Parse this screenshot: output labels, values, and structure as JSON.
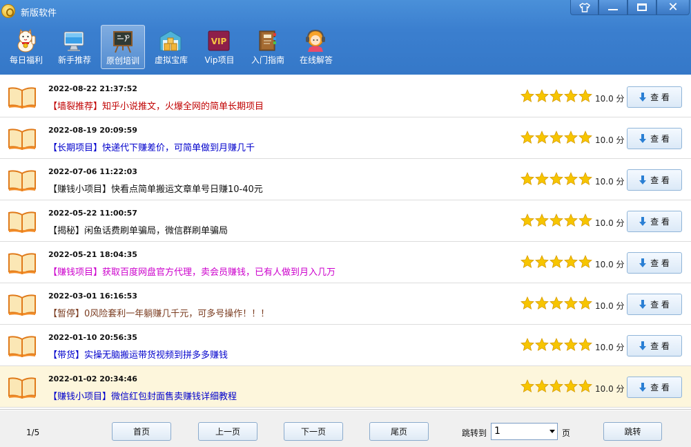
{
  "window": {
    "title": "新版软件"
  },
  "nav": {
    "items": [
      {
        "label": "每日福利",
        "icon": "lucky-cat-icon"
      },
      {
        "label": "新手推荐",
        "icon": "monitor-icon"
      },
      {
        "label": "原创培训",
        "icon": "blackboard-icon",
        "active": true
      },
      {
        "label": "虚拟宝库",
        "icon": "warehouse-icon"
      },
      {
        "label": "Vip项目",
        "icon": "vip-icon",
        "badge": "VIP"
      },
      {
        "label": "入门指南",
        "icon": "guide-book-icon"
      },
      {
        "label": "在线解答",
        "icon": "support-agent-icon"
      }
    ]
  },
  "list": {
    "items": [
      {
        "date": "2022-08-22 21:37:52",
        "title": "【墙裂推荐】知乎小说推文，火爆全网的简单长期项目",
        "color": "#c00000",
        "rating": 5,
        "score": "10.0 分",
        "button": "查 看"
      },
      {
        "date": "2022-08-19 20:09:59",
        "title": "【长期项目】快递代下赚差价，可简单做到月赚几千",
        "color": "#0000cc",
        "rating": 5,
        "score": "10.0 分",
        "button": "查 看"
      },
      {
        "date": "2022-07-06 11:22:03",
        "title": "【赚钱小项目】快看点简单搬运文章单号日赚10-40元",
        "color": "#111111",
        "rating": 5,
        "score": "10.0 分",
        "button": "查 看"
      },
      {
        "date": "2022-05-22 11:00:57",
        "title": "【揭秘】闲鱼话费刷单骗局，微信群刷单骗局",
        "color": "#111111",
        "rating": 5,
        "score": "10.0 分",
        "button": "查 看"
      },
      {
        "date": "2022-05-21 18:04:35",
        "title": "【赚钱项目】获取百度网盘官方代理，卖会员赚钱，已有人做到月入几万",
        "color": "#cc00cc",
        "rating": 5,
        "score": "10.0 分",
        "button": "查 看"
      },
      {
        "date": "2022-03-01 16:16:53",
        "title": "【暂停】0风险套利一年躺赚几千元，可多号操作！！！",
        "color": "#7a3b1f",
        "rating": 5,
        "score": "10.0 分",
        "button": "查 看"
      },
      {
        "date": "2022-01-10 20:56:35",
        "title": "【带货】实操无脑搬运带货视频到拼多多赚钱",
        "color": "#0000cc",
        "rating": 5,
        "score": "10.0 分",
        "button": "查 看"
      },
      {
        "date": "2022-01-02 20:34:46",
        "title": "【赚钱小项目】微信红包封面售卖赚钱详细教程",
        "color": "#0000cc",
        "rating": 5,
        "score": "10.0 分",
        "button": "查 看",
        "highlight": true
      }
    ]
  },
  "pagination": {
    "indicator": "1/5",
    "first": "首页",
    "prev": "上一页",
    "next": "下一页",
    "last": "尾页",
    "jump_label": "跳转到",
    "current_page": "1",
    "page_unit": "页",
    "jump_button": "跳转"
  },
  "colors": {
    "titlebar": "#3b7fcf",
    "star": "#f7c500",
    "highlight_row": "#fdf6dc"
  }
}
